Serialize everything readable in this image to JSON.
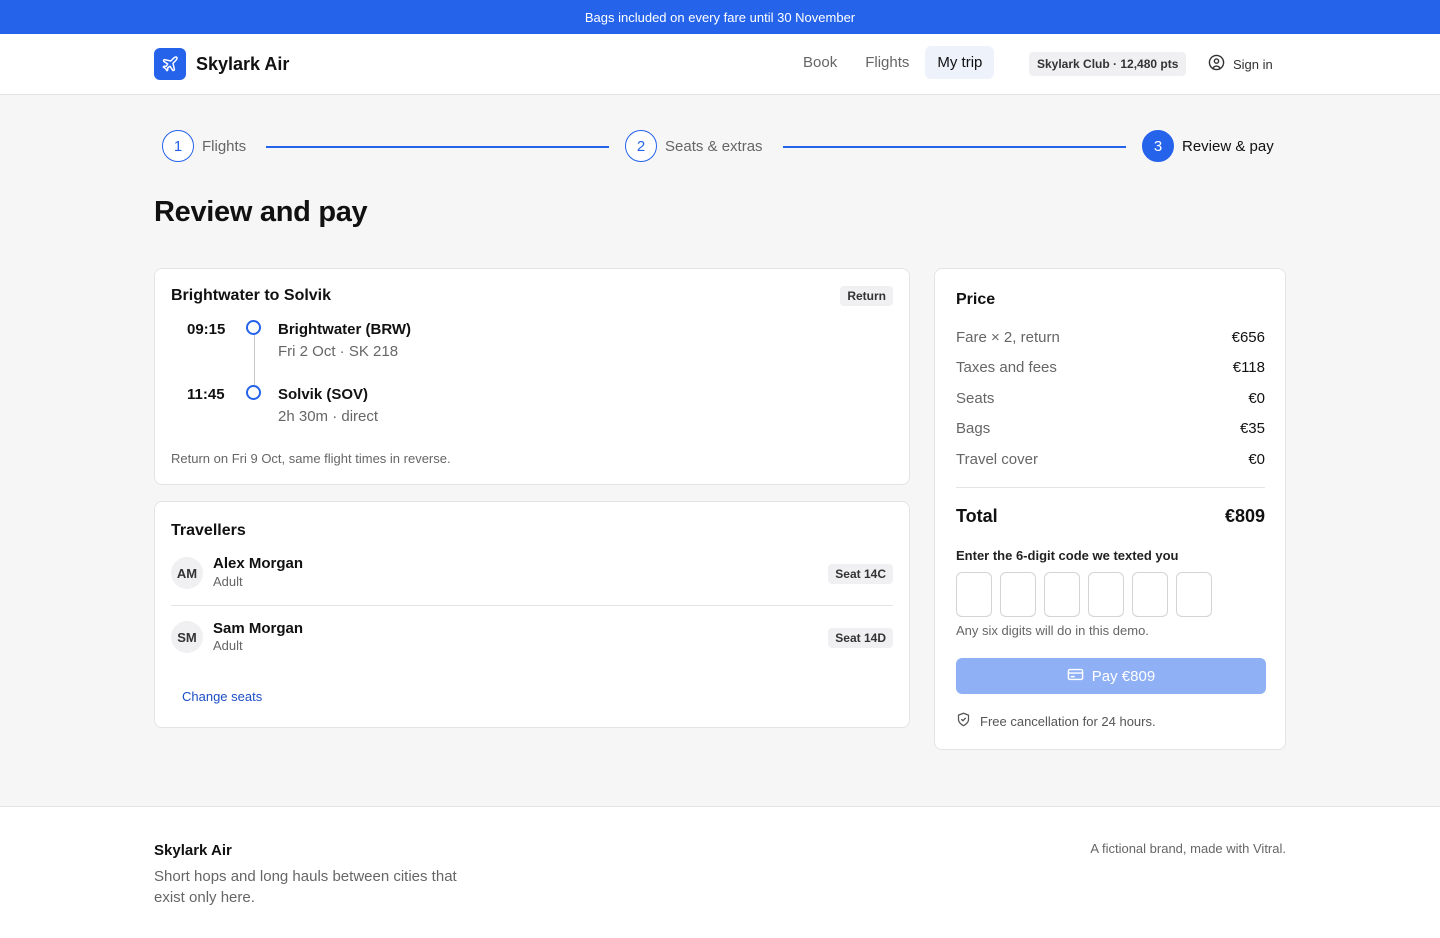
{
  "promo": {
    "text": "Bags included on every fare until 30 November"
  },
  "header": {
    "brand": "Skylark Air",
    "nav": [
      {
        "label": "Book"
      },
      {
        "label": "Flights"
      },
      {
        "label": "My trip",
        "active": true
      }
    ],
    "club_badge": "Skylark Club · 12,480 pts",
    "sign_in": "Sign in"
  },
  "stepper": {
    "steps": [
      {
        "number": "1",
        "label": "Flights"
      },
      {
        "number": "2",
        "label": "Seats & extras"
      },
      {
        "number": "3",
        "label": "Review & pay",
        "current": true
      }
    ]
  },
  "page_title": "Review and pay",
  "trip": {
    "title": "Brightwater to Solvik",
    "badge": "Return",
    "departure": {
      "time": "09:15",
      "place": "Brightwater (BRW)",
      "detail": "Fri 2 Oct · SK 218"
    },
    "arrival": {
      "time": "11:45",
      "place": "Solvik (SOV)",
      "detail": "2h 30m · direct"
    },
    "return_note": "Return on Fri 9 Oct, same flight times in reverse."
  },
  "travellers": {
    "title": "Travellers",
    "list": [
      {
        "initials": "AM",
        "name": "Alex Morgan",
        "type": "Adult",
        "seat": "Seat 14C"
      },
      {
        "initials": "SM",
        "name": "Sam Morgan",
        "type": "Adult",
        "seat": "Seat 14D"
      }
    ],
    "change_link": "Change seats"
  },
  "price": {
    "title": "Price",
    "lines": [
      {
        "label": "Fare × 2, return",
        "value": "€656"
      },
      {
        "label": "Taxes and fees",
        "value": "€118"
      },
      {
        "label": "Seats",
        "value": "€0"
      },
      {
        "label": "Bags",
        "value": "€35"
      },
      {
        "label": "Travel cover",
        "value": "€0"
      }
    ],
    "total_label": "Total",
    "total_value": "€809",
    "code_label": "Enter the 6-digit code we texted you",
    "code_hint": "Any six digits will do in this demo.",
    "pay_label": "Pay €809",
    "cancel_note": "Free cancellation for 24 hours."
  },
  "footer": {
    "brand": "Skylark Air",
    "description": "Short hops and long hauls between cities that exist only here.",
    "right_note": "A fictional brand, made with Vitral."
  },
  "colors": {
    "accent": "#2563eb",
    "pay_disabled": "#8fb0f4",
    "link": "#1d4fc4"
  }
}
